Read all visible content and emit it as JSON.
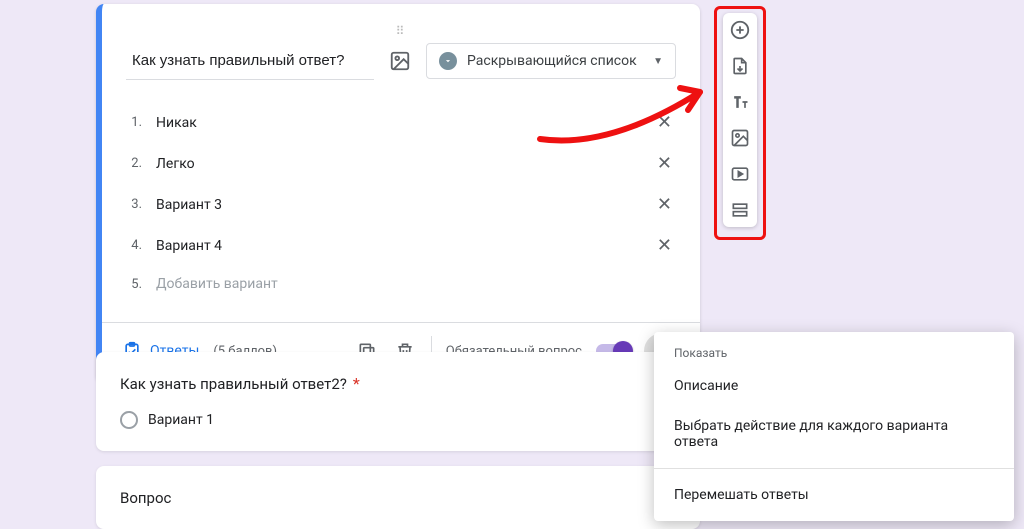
{
  "question1": {
    "title": "Как узнать правильный ответ?",
    "type_label": "Раскрывающийся список",
    "options": [
      {
        "n": "1.",
        "text": "Никак"
      },
      {
        "n": "2.",
        "text": "Легко"
      },
      {
        "n": "3.",
        "text": "Вариант 3"
      },
      {
        "n": "4.",
        "text": "Вариант 4"
      }
    ],
    "add_option_n": "5.",
    "add_option_text": "Добавить вариант",
    "answers_label": "Ответы",
    "points_label": "(5 баллов)",
    "required_label": "Обязательный вопрос"
  },
  "question2": {
    "title": "Как узнать правильный ответ2?",
    "option1": "Вариант 1"
  },
  "question3": {
    "title": "Вопрос"
  },
  "menu": {
    "header": "Показать",
    "item1": "Описание",
    "item2": "Выбрать действие для каждого варианта ответа",
    "item3": "Перемешать ответы"
  }
}
